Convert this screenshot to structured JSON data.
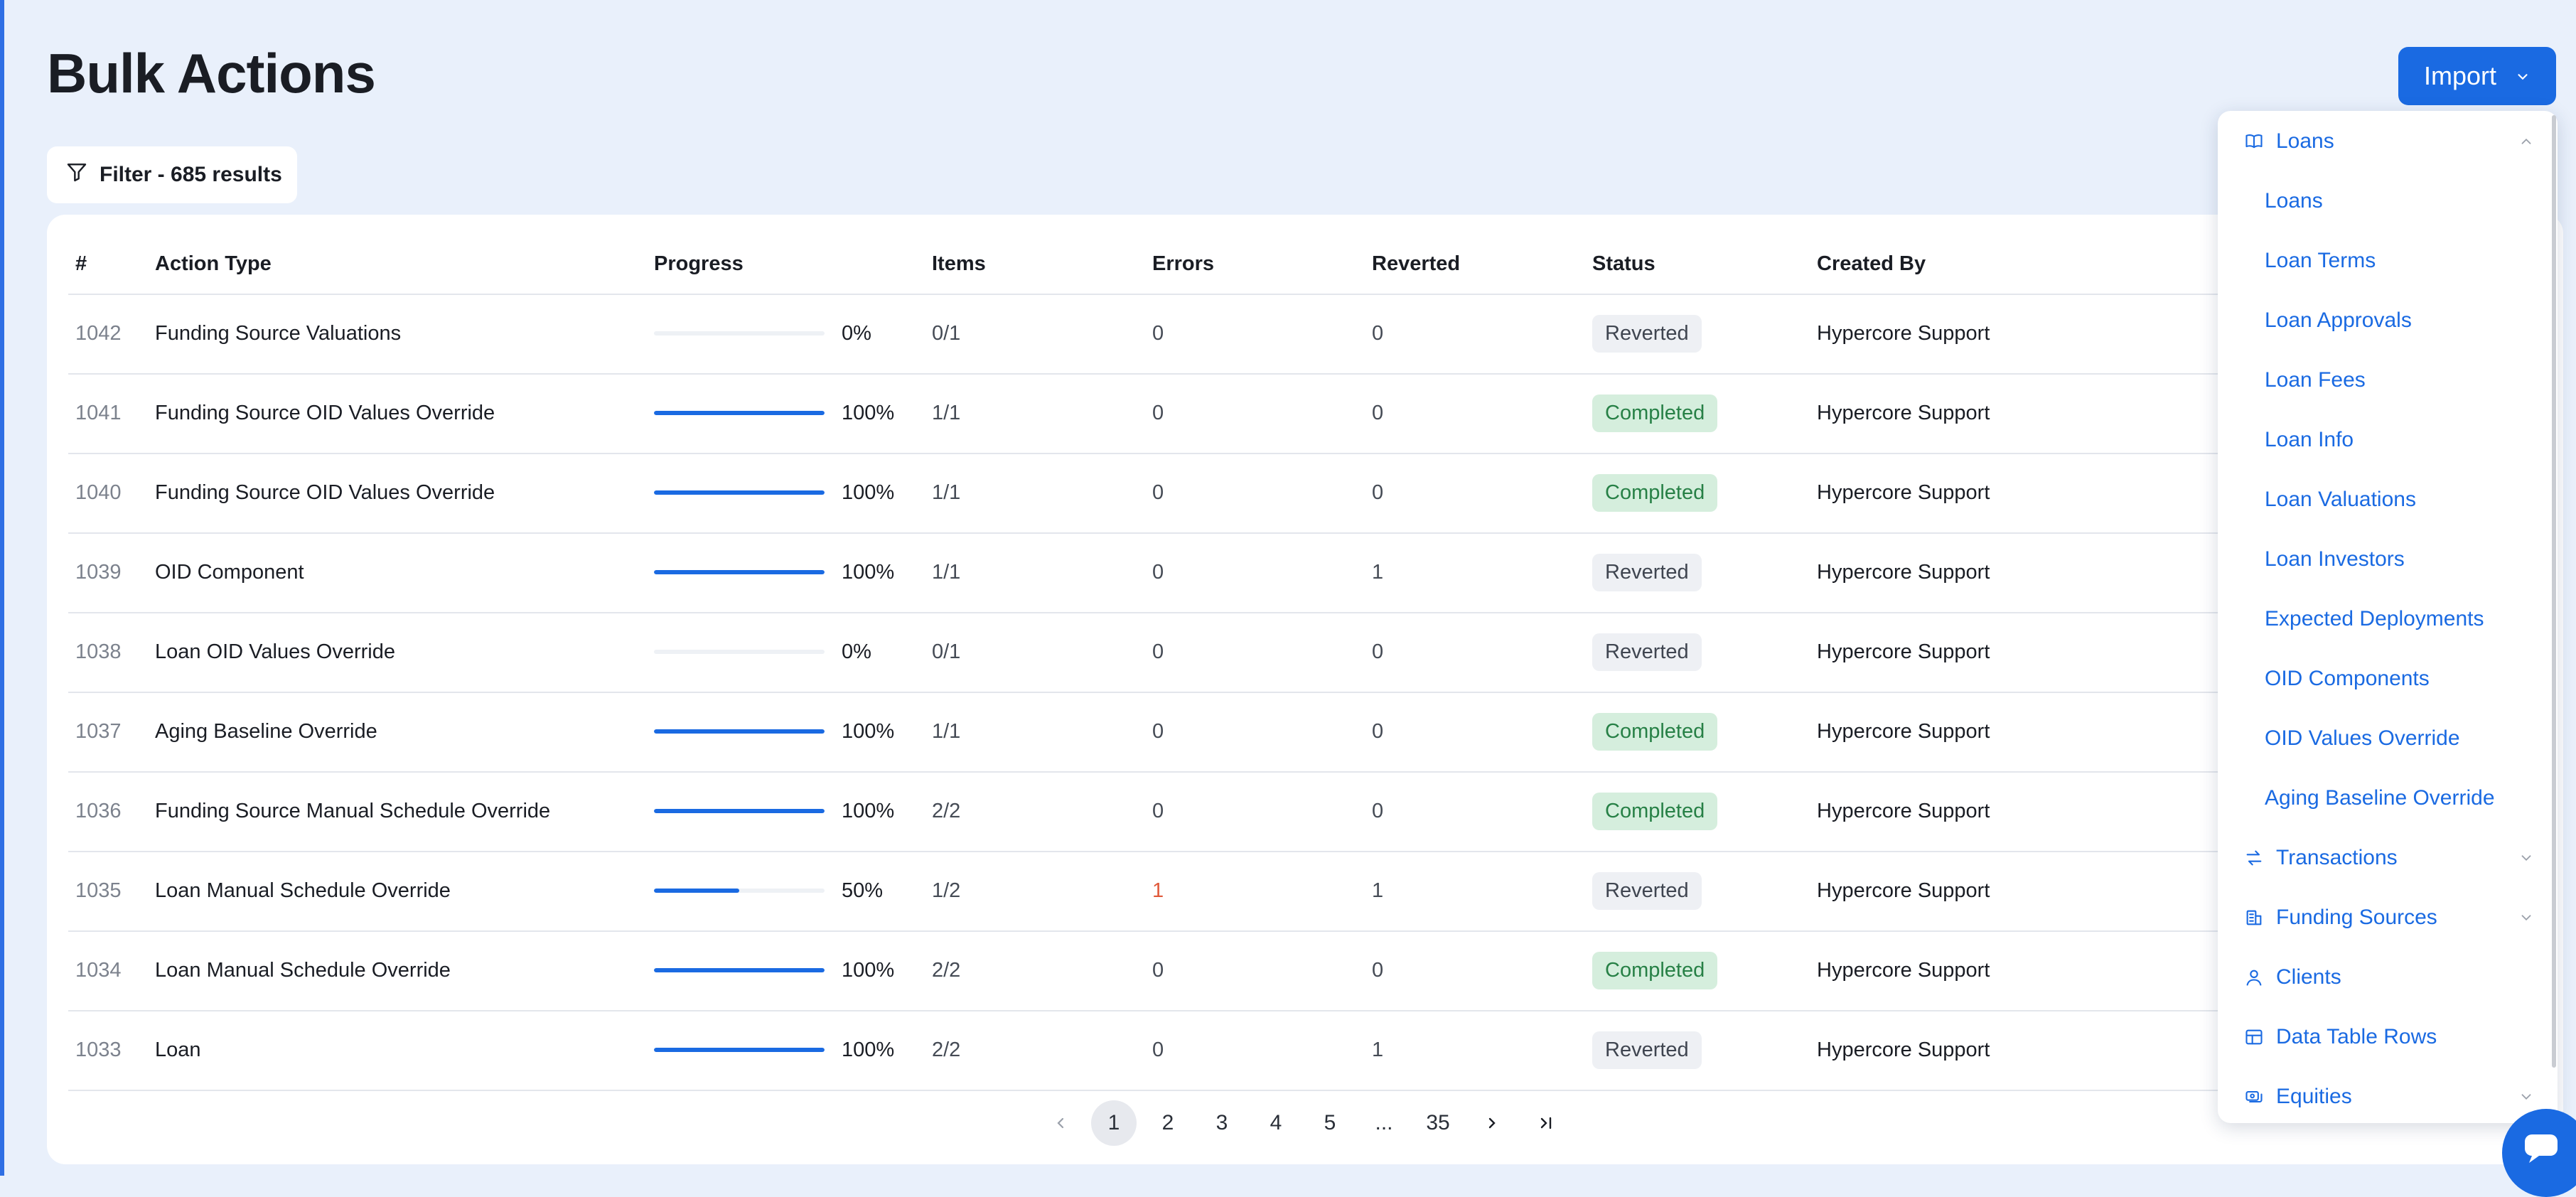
{
  "page": {
    "title": "Bulk Actions"
  },
  "filter": {
    "label": "Filter - 685 results"
  },
  "import_button": {
    "label": "Import"
  },
  "table": {
    "columns": [
      "#",
      "Action Type",
      "Progress",
      "Items",
      "Errors",
      "Reverted",
      "Status",
      "Created By"
    ],
    "rows": [
      {
        "id": "1042",
        "action_type": "Funding Source Valuations",
        "progress": 0,
        "progress_label": "0%",
        "items": "0/1",
        "errors": "0",
        "reverted": "0",
        "status": "Reverted",
        "created_by": "Hypercore Support"
      },
      {
        "id": "1041",
        "action_type": "Funding Source OID Values Override",
        "progress": 100,
        "progress_label": "100%",
        "items": "1/1",
        "errors": "0",
        "reverted": "0",
        "status": "Completed",
        "created_by": "Hypercore Support"
      },
      {
        "id": "1040",
        "action_type": "Funding Source OID Values Override",
        "progress": 100,
        "progress_label": "100%",
        "items": "1/1",
        "errors": "0",
        "reverted": "0",
        "status": "Completed",
        "created_by": "Hypercore Support"
      },
      {
        "id": "1039",
        "action_type": "OID Component",
        "progress": 100,
        "progress_label": "100%",
        "items": "1/1",
        "errors": "0",
        "reverted": "1",
        "status": "Reverted",
        "created_by": "Hypercore Support"
      },
      {
        "id": "1038",
        "action_type": "Loan OID Values Override",
        "progress": 0,
        "progress_label": "0%",
        "items": "0/1",
        "errors": "0",
        "reverted": "0",
        "status": "Reverted",
        "created_by": "Hypercore Support"
      },
      {
        "id": "1037",
        "action_type": "Aging Baseline Override",
        "progress": 100,
        "progress_label": "100%",
        "items": "1/1",
        "errors": "0",
        "reverted": "0",
        "status": "Completed",
        "created_by": "Hypercore Support"
      },
      {
        "id": "1036",
        "action_type": "Funding Source Manual Schedule Override",
        "progress": 100,
        "progress_label": "100%",
        "items": "2/2",
        "errors": "0",
        "reverted": "0",
        "status": "Completed",
        "created_by": "Hypercore Support"
      },
      {
        "id": "1035",
        "action_type": "Loan Manual Schedule Override",
        "progress": 50,
        "progress_label": "50%",
        "items": "1/2",
        "errors": "1",
        "reverted": "1",
        "status": "Reverted",
        "created_by": "Hypercore Support"
      },
      {
        "id": "1034",
        "action_type": "Loan Manual Schedule Override",
        "progress": 100,
        "progress_label": "100%",
        "items": "2/2",
        "errors": "0",
        "reverted": "0",
        "status": "Completed",
        "created_by": "Hypercore Support"
      },
      {
        "id": "1033",
        "action_type": "Loan",
        "progress": 100,
        "progress_label": "100%",
        "items": "2/2",
        "errors": "0",
        "reverted": "1",
        "status": "Reverted",
        "created_by": "Hypercore Support"
      }
    ]
  },
  "pagination": {
    "pages": [
      "1",
      "2",
      "3",
      "4",
      "5",
      "...",
      "35"
    ],
    "current": "1"
  },
  "import_menu": {
    "items": [
      {
        "label": "Loans",
        "icon": "book-open-icon",
        "expanded": true
      },
      {
        "label": "Loans",
        "sub": true
      },
      {
        "label": "Loan Terms",
        "sub": true
      },
      {
        "label": "Loan Approvals",
        "sub": true
      },
      {
        "label": "Loan Fees",
        "sub": true
      },
      {
        "label": "Loan Info",
        "sub": true
      },
      {
        "label": "Loan Valuations",
        "sub": true
      },
      {
        "label": "Loan Investors",
        "sub": true
      },
      {
        "label": "Expected Deployments",
        "sub": true
      },
      {
        "label": "OID Components",
        "sub": true
      },
      {
        "label": "OID Values Override",
        "sub": true
      },
      {
        "label": "Aging Baseline Override",
        "sub": true
      },
      {
        "label": "Transactions",
        "icon": "arrows-swap-icon",
        "expandable": true
      },
      {
        "label": "Funding Sources",
        "icon": "building-icon",
        "expandable": true
      },
      {
        "label": "Clients",
        "icon": "user-icon"
      },
      {
        "label": "Data Table Rows",
        "icon": "table-icon"
      },
      {
        "label": "Equities",
        "icon": "coins-icon",
        "expandable": true
      }
    ]
  },
  "colors": {
    "accent": "#1a6ae2",
    "completed_bg": "#d5eedd",
    "completed_text": "#278046",
    "reverted_bg": "#eef0f4",
    "error_text": "#e0593a"
  }
}
